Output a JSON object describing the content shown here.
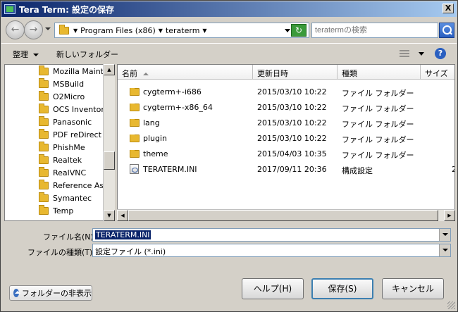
{
  "window": {
    "title": "Tera Term: 設定の保存",
    "close_label": "X"
  },
  "address": {
    "crumbs": [
      "Program Files (x86)",
      "teraterm"
    ],
    "search_placeholder": "teratermの検索"
  },
  "toolbar": {
    "organize": "整理",
    "new_folder": "新しいフォルダー",
    "help": "?"
  },
  "tree": {
    "items": [
      "Mozilla Maintenance",
      "MSBuild",
      "O2Micro",
      "OCS Inventory",
      "Panasonic",
      "PDF reDirect",
      "PhishMe",
      "Realtek",
      "RealVNC",
      "Reference Assemblies",
      "Symantec",
      "Temp"
    ]
  },
  "list": {
    "columns": {
      "name": "名前",
      "modified": "更新日時",
      "type": "種類",
      "size": "サイズ"
    },
    "rows": [
      {
        "name": "cygterm+-i686",
        "modified": "2015/03/10 10:22",
        "type": "ファイル フォルダー",
        "size": "",
        "icon": "folder-icon"
      },
      {
        "name": "cygterm+-x86_64",
        "modified": "2015/03/10 10:22",
        "type": "ファイル フォルダー",
        "size": "",
        "icon": "folder-icon"
      },
      {
        "name": "lang",
        "modified": "2015/03/10 10:22",
        "type": "ファイル フォルダー",
        "size": "",
        "icon": "folder-icon"
      },
      {
        "name": "plugin",
        "modified": "2015/03/10 10:22",
        "type": "ファイル フォルダー",
        "size": "",
        "icon": "folder-icon"
      },
      {
        "name": "theme",
        "modified": "2015/04/03 10:35",
        "type": "ファイル フォルダー",
        "size": "",
        "icon": "folder-icon"
      },
      {
        "name": "TERATERM.INI",
        "modified": "2017/09/11 20:36",
        "type": "構成設定",
        "size": "2",
        "icon": "settings-file-icon"
      }
    ]
  },
  "fields": {
    "filename_label": "ファイル名(N):",
    "filename_value": "TERATERM.INI",
    "filetype_label": "ファイルの種類(T):",
    "filetype_value": "設定ファイル (*.ini)"
  },
  "buttons": {
    "hide_folders": "フォルダーの非表示",
    "help": "ヘルプ(H)",
    "save": "保存(S)",
    "cancel": "キャンセル"
  }
}
